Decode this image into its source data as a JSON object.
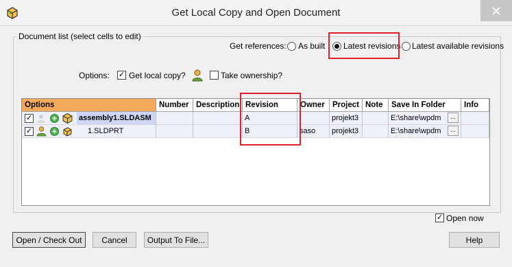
{
  "window": {
    "title": "Get Local Copy and Open Document",
    "close_icon": "close-icon"
  },
  "group": {
    "label": "Document list (select cells to edit)"
  },
  "references": {
    "label": "Get references:",
    "options": [
      {
        "label": "As built",
        "selected": false
      },
      {
        "label": "Latest revisions",
        "selected": true
      },
      {
        "label": "Latest available revisions",
        "selected": false
      }
    ]
  },
  "options_row": {
    "label": "Options:",
    "get_local_copy": {
      "label": "Get local copy?",
      "checked": true
    },
    "take_ownership": {
      "label": "Take ownership?",
      "checked": false
    }
  },
  "grid": {
    "columns": [
      "Options",
      "Number",
      "Description",
      "Revision",
      "Owner",
      "Project",
      "Note",
      "Save In Folder",
      "Info"
    ],
    "rows": [
      {
        "checked": true,
        "name": "assembly1.SLDASM",
        "number": "",
        "description": "",
        "revision": "A",
        "owner": "",
        "project": "projekt3",
        "note": "",
        "folder": "E:\\share\\wpdm",
        "browse": "...",
        "info": ""
      },
      {
        "checked": true,
        "name": "1.SLDPRT",
        "number": "",
        "description": "",
        "revision": "B",
        "owner": "saso",
        "project": "projekt3",
        "note": "",
        "folder": "E:\\share\\wpdm",
        "browse": "...",
        "info": ""
      }
    ]
  },
  "open_now": {
    "label": "Open now",
    "checked": true
  },
  "buttons": {
    "open_checkout": "Open / Check Out",
    "cancel": "Cancel",
    "output": "Output To File...",
    "help": "Help"
  },
  "colors": {
    "highlight": "#e0202a",
    "options_header": "#f4aa5c",
    "selected_cell": "#cdd7f3"
  }
}
